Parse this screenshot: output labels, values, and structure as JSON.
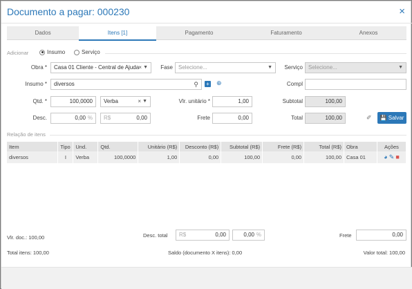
{
  "dialog": {
    "title": "Documento a pagar: 000230",
    "close_icon": "×"
  },
  "tabs": [
    {
      "label": "Dados"
    },
    {
      "label": "Itens [1]"
    },
    {
      "label": "Pagamento"
    },
    {
      "label": "Faturamento"
    },
    {
      "label": "Anexos"
    }
  ],
  "form": {
    "adicionar_label": "Adicionar",
    "radio_insumo": "Insumo",
    "radio_servico": "Serviço",
    "obra_label": "Obra *",
    "obra_value": "Casa 01 Cliente - Central de Ajuda",
    "fase_label": "Fase",
    "fase_placeholder": "Selecione...",
    "servico_label": "Serviço",
    "servico_placeholder": "Selecione...",
    "insumo_label": "Insumo *",
    "insumo_value": "diversos",
    "compl_label": "Compl",
    "compl_value": "",
    "qtd_label": "Qtd. *",
    "qtd_value": "100,0000",
    "unidade_value": "Verba",
    "vlr_unitario_label": "Vlr. unitário *",
    "vlr_unitario_value": "1,00",
    "subtotal_label": "Subtotal",
    "subtotal_value": "100,00",
    "desc_label": "Desc.",
    "desc_pct_value": "0,00",
    "pct_symbol": "%",
    "rs_symbol": "R$",
    "desc_rs_value": "0,00",
    "frete_label": "Frete",
    "frete_value": "0,00",
    "total_label": "Total",
    "total_value": "100,00",
    "save_label": "Salvar"
  },
  "relacao_label": "Relação de itens",
  "table": {
    "columns": [
      "Item",
      "Tipo",
      "Und.",
      "Qtd.",
      "Unitário (R$)",
      "Desconto (R$)",
      "Subtotal (R$)",
      "Frete (R$)",
      "Total (R$)",
      "Obra",
      "Ações"
    ],
    "rows": [
      [
        "diversos",
        "I",
        "Verba",
        "100,0000",
        "1,00",
        "0,00",
        "100,00",
        "0,00",
        "100,00",
        "Casa 01",
        ""
      ]
    ]
  },
  "footer": {
    "vlr_doc": "Vlr. doc.: 100,00",
    "desc_total_label": "Desc. total",
    "desc_total_rs": "0,00",
    "desc_total_pct": "0,00",
    "frete_label": "Frete",
    "frete_value": "0,00",
    "total_itens": "Total itens: 100,00",
    "saldo": "Saldo (documento X itens): 0,00",
    "valor_total": "Valor total: 100,00"
  },
  "colors": {
    "accent": "#2c78b8",
    "delete": "#d9534f"
  }
}
